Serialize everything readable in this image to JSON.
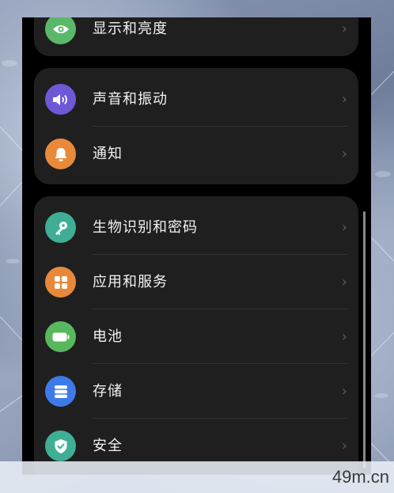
{
  "groups": [
    {
      "items": [
        {
          "label": "显示和亮度",
          "icon": "eye-icon",
          "color": "#5bb86b"
        }
      ]
    },
    {
      "items": [
        {
          "label": "声音和振动",
          "icon": "speaker-icon",
          "color": "#6f58d6"
        },
        {
          "label": "通知",
          "icon": "bell-icon",
          "color": "#e88a3a"
        }
      ]
    },
    {
      "items": [
        {
          "label": "生物识别和密码",
          "icon": "key-icon",
          "color": "#3fae95"
        },
        {
          "label": "应用和服务",
          "icon": "apps-grid-icon",
          "color": "#e8893a"
        },
        {
          "label": "电池",
          "icon": "battery-icon",
          "color": "#58b85e"
        },
        {
          "label": "存储",
          "icon": "storage-icon",
          "color": "#3d7be8"
        },
        {
          "label": "安全",
          "icon": "shield-check-icon",
          "color": "#3fae95"
        }
      ]
    }
  ],
  "chevron": "›",
  "watermark": "49m.cn"
}
